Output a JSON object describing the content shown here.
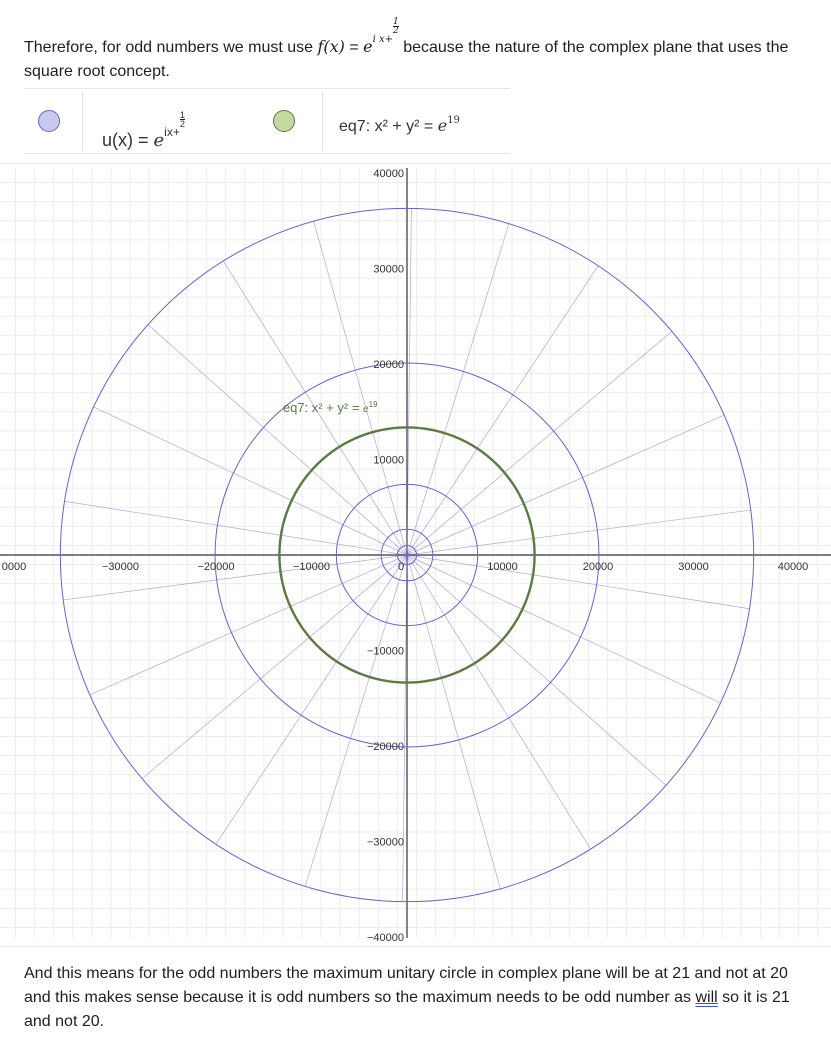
{
  "intro": {
    "before": "Therefore, for odd numbers we must use ",
    "func": "f",
    "arg": "(x)",
    "equals": " = ",
    "base": "e",
    "exp_i": "i",
    "exp_x": "x+",
    "frac_num": "1",
    "frac_den": "2",
    "after": " because the nature of the complex plane that uses the square root concept."
  },
  "algebra": [
    {
      "label": "u(x)",
      "eq": " = ",
      "base": "e",
      "exp": "ix+",
      "frac_num": "1",
      "frac_den": "2",
      "color": "#6b62c8"
    },
    {
      "label": "eq7: x² + y² = ",
      "base": "e",
      "exp": "19",
      "color": "#5d7a44"
    }
  ],
  "graph": {
    "x_ticks": [
      "0000",
      "−30000",
      "−20000",
      "−10000",
      "0",
      "10000",
      "20000",
      "30000",
      "40000"
    ],
    "y_ticks": [
      "40000",
      "30000",
      "20000",
      "10000",
      "−10000",
      "−20000",
      "−30000",
      "−40000"
    ],
    "curve_label": "eq7: x² + y² = ",
    "curve_label_base": "e",
    "curve_label_exp": "19",
    "colors": {
      "spiral": "#6b62c8",
      "circle": "#5d7a44",
      "grid_major": "#d0d0d0",
      "grid_minor": "#ededed",
      "axis": "#333333"
    },
    "chart_data": {
      "type": "curve",
      "unit_circle_radius_sq_exp": 19,
      "circle_radius": 13360,
      "spiral_radii": [
        1000,
        2700,
        7400,
        20100,
        36300
      ],
      "xlim": [
        -40000,
        40000
      ],
      "ylim": [
        -40000,
        40000
      ]
    }
  },
  "outro": {
    "line1": "And this means for the odd numbers the maximum unitary circle in complex plane will be at 21 and not at 20 and this makes sense because it is odd numbers so the maximum needs to be odd number as ",
    "underlined": "will",
    "line2": " so it is 21 and not 20."
  }
}
